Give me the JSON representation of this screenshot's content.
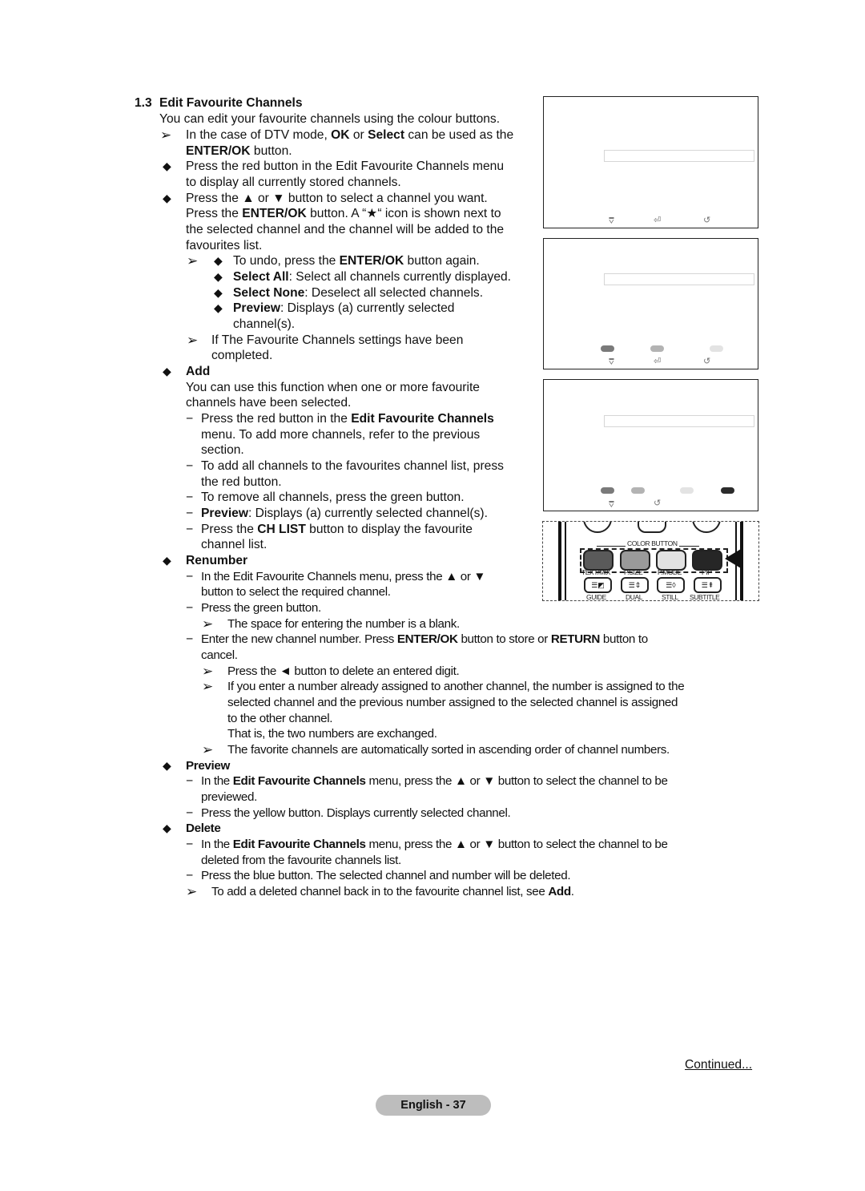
{
  "section": {
    "number": "1.3",
    "title": "Edit Favourite Channels",
    "intro": "You can edit your favourite channels using the colour buttons."
  },
  "icons": {
    "arrow_note": "➢",
    "bullet_diamond": "◆",
    "dash": "−"
  },
  "intro_items": [
    {
      "type": "note",
      "parts": [
        "In the case of DTV mode, ",
        "OK",
        " or ",
        "Select",
        " can be used as the"
      ],
      "cont": [
        "ENTER/OK",
        " button."
      ]
    },
    {
      "type": "bullet",
      "lines": [
        "Press the red button in the Edit Favourite Channels menu",
        "to display all currently stored channels."
      ]
    },
    {
      "type": "bullet",
      "lines": [
        "Press the ▲ or ▼ button to select a channel you want."
      ],
      "line2_parts": [
        "Press the ",
        "ENTER/OK",
        " button. A “★“ icon is shown next to"
      ],
      "line3": "the selected channel and the channel will be added to the",
      "line4": "favourites list."
    }
  ],
  "sub_notes": {
    "undo": [
      "To undo, press the ",
      "ENTER/OK",
      " button again."
    ],
    "select_all": [
      "Select All",
      ": Select all channels currently displayed."
    ],
    "select_none": [
      "Select None",
      ": Deselect all selected channels."
    ],
    "preview": [
      "Preview",
      ": Displays (a) currently selected"
    ],
    "preview_cont": "channel(s).",
    "completed": [
      "If The Favourite Channels settings have been",
      "completed."
    ]
  },
  "add": {
    "heading": "Add",
    "desc": [
      "You can use this function when one or more favourite",
      "channels have been selected."
    ],
    "items": {
      "red_menu": [
        "Press the red button in the ",
        "Edit Favourite Channels"
      ],
      "red_menu_cont": [
        "menu. To add more channels, refer to the previous",
        "section."
      ],
      "add_all": [
        "To add all channels to the favourites channel list, press",
        "the red button."
      ],
      "remove_all": "To remove all channels, press the green button.",
      "preview": [
        "Preview",
        ": Displays (a) currently selected channel(s)."
      ],
      "ch_list": [
        "Press the ",
        "CH LIST",
        " button to display the favourite"
      ],
      "ch_list_cont": "channel list."
    }
  },
  "renumber": {
    "heading": "Renumber",
    "select": [
      "In the Edit Favourite Channels menu, press the ▲ or ▼",
      "button to select the required channel."
    ],
    "green": "Press the green button.",
    "blank_note": "The space for entering the number is a blank.",
    "enter": [
      "Enter the new channel number. Press ",
      "ENTER/OK",
      " button to store or ",
      "RETURN",
      " button to"
    ],
    "enter_cont": "cancel.",
    "delete_digit": "Press the ◄ button to delete an entered digit.",
    "assigned": [
      "If you enter a number already assigned to another channel, the number is assigned to the",
      "selected channel and the previous number assigned to the selected channel is assigned",
      "to the other channel.",
      "That is, the two numbers are exchanged."
    ],
    "sorted": "The favorite channels are automatically sorted in ascending order of channel numbers."
  },
  "preview": {
    "heading": "Preview",
    "select": [
      "In the ",
      "Edit Favourite Channels",
      " menu, press the ▲ or ▼ button to select the channel to be"
    ],
    "select_cont": "previewed.",
    "yellow": "Press the yellow button. Displays currently selected channel."
  },
  "delete": {
    "heading": "Delete",
    "select": [
      "In the ",
      "Edit Favourite Channels",
      " menu, press the ▲ or ▼ button to select the channel to be"
    ],
    "select_cont": "deleted from the favourite channels list.",
    "blue": "Press the blue button. The selected channel and number will be deleted.",
    "note": [
      "To add a deleted channel back in to the favourite channel list, see ",
      "Add",
      "."
    ]
  },
  "screens": {
    "icons": {
      "move": "⩢",
      "enter": "⏎",
      "return": "↺"
    },
    "colors": {
      "red": "#7a7a7a",
      "green": "#b3b3b3",
      "yellow": "#e3e3e3",
      "blue": "#2b2b2b"
    }
  },
  "remote": {
    "color_button_label": "COLOR BUTTON",
    "buttons": [
      {
        "label": "TEXT/MIX",
        "color": "#5a5a5a",
        "sub_label": "GUIDE",
        "sub_icon": "☰◩"
      },
      {
        "label": "P.SIZE",
        "color": "#9a9a9a",
        "sub_label": "DUAL",
        "sub_icon": "☰⇕"
      },
      {
        "label": "P.MODE",
        "color": "#e2e2e2",
        "sub_label": "STILL",
        "sub_icon": "☰◊"
      },
      {
        "label": "PIP",
        "color": "#262626",
        "sub_label": "SUBTITLE",
        "sub_icon": "☰⇞"
      }
    ]
  },
  "footer": {
    "continued": "Continued...",
    "page": "English - 37"
  }
}
